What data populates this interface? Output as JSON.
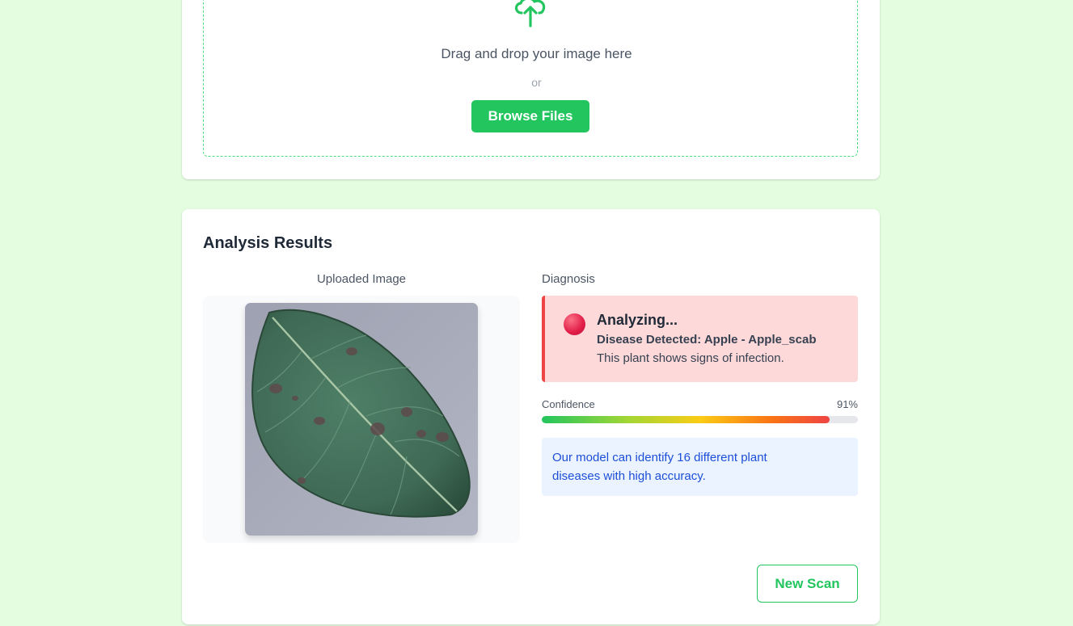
{
  "upload": {
    "icon": "cloud-upload-icon",
    "drop_text": "Drag and drop your image here",
    "or_text": "or",
    "browse_label": "Browse Files"
  },
  "results": {
    "title": "Analysis Results",
    "uploaded_image_label": "Uploaded Image",
    "diagnosis_label": "Diagnosis",
    "status_title": "Analyzing...",
    "disease_text": "Disease Detected: Apple - Apple_scab",
    "infection_text": "This plant shows signs of infection.",
    "confidence_label": "Confidence",
    "confidence_value": "91%",
    "confidence_fraction": 0.91,
    "info_text": "Our model can identify 16 different plant diseases with high accuracy.",
    "new_scan_label": "New Scan"
  },
  "colors": {
    "background": "#e4fde1",
    "accent": "#22c55e",
    "danger": "#ef4444",
    "danger_bg": "#fdd9d9",
    "info_bg": "#eaf3ff",
    "info_text": "#1d4ed8"
  }
}
